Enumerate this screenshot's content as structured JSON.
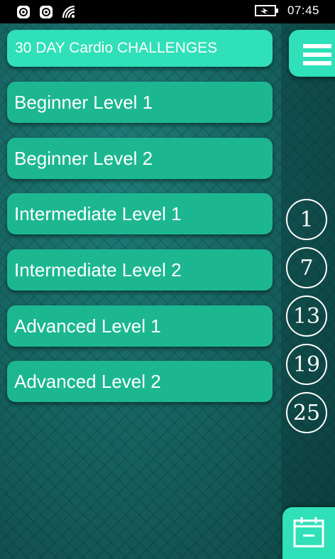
{
  "status_bar": {
    "icons": [
      "notification-app-icon",
      "notification-app-icon",
      "wifi-icon"
    ],
    "battery_icon": "battery-charging-icon",
    "time": "07:45"
  },
  "header": {
    "title": "30 DAY Cardio CHALLENGES"
  },
  "menu": {
    "icon": "hamburger-menu-icon"
  },
  "levels": [
    {
      "label": "Beginner Level 1"
    },
    {
      "label": "Beginner Level 2"
    },
    {
      "label": "Intermediate Level 1"
    },
    {
      "label": "Intermediate Level 2"
    },
    {
      "label": "Advanced Level 1"
    },
    {
      "label": "Advanced Level 2"
    }
  ],
  "days": [
    "1",
    "7",
    "13",
    "19",
    "25"
  ],
  "calendar": {
    "icon": "calendar-icon"
  },
  "colors": {
    "accent_light": "#2fe0b8",
    "accent": "#1cb791",
    "background": "#155f5d"
  }
}
